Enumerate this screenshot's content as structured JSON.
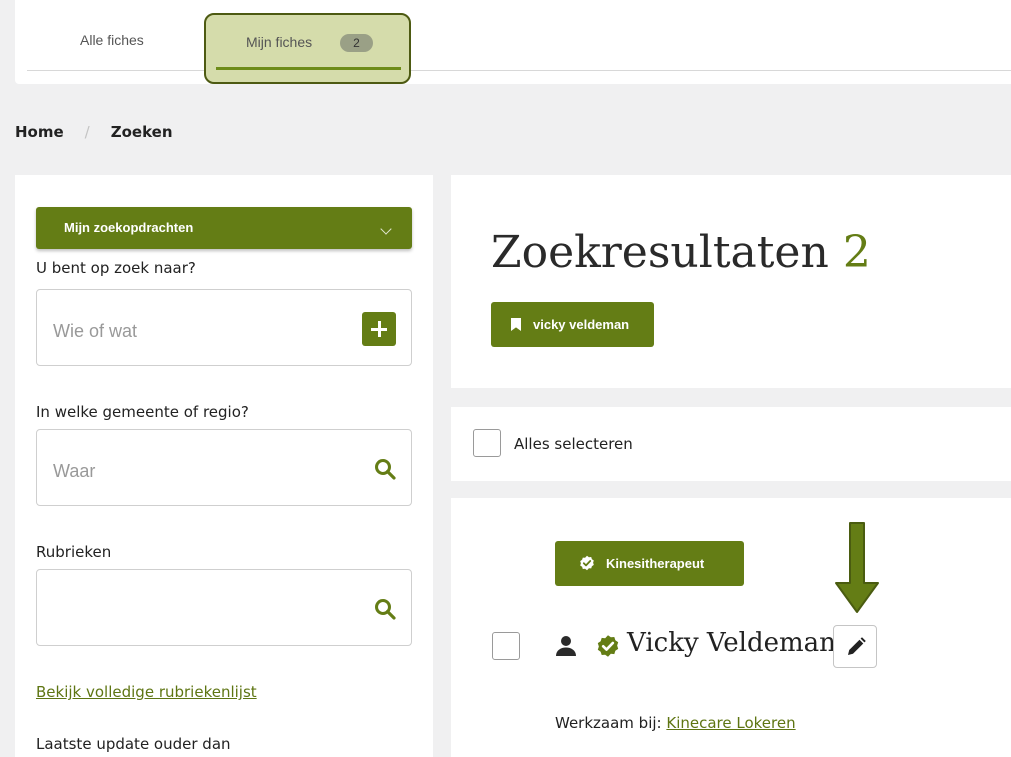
{
  "tabs": {
    "all_label": "Alle fiches",
    "mine_label": "Mijn fiches",
    "mine_count": "2"
  },
  "breadcrumb": {
    "home": "Home",
    "separator": "/",
    "current": "Zoeken"
  },
  "sidebar": {
    "my_searches_label": "Mijn zoekopdrachten",
    "what_label": "U bent op zoek naar?",
    "what_placeholder": "Wie of wat",
    "where_label": "In welke gemeente of regio?",
    "where_placeholder": "Waar",
    "categories_label": "Rubrieken",
    "categories_value": "",
    "full_list_link": "Bekijk volledige rubriekenlijst",
    "last_update_label": "Laatste update ouder dan"
  },
  "results": {
    "title": "Zoekresultaten",
    "count": "2",
    "saved_search_label": "vicky veldeman",
    "select_all_label": "Alles selecteren",
    "items": [
      {
        "badge": "Kinesitherapeut",
        "name": "Vicky Veldeman",
        "works_at_label": "Werkzaam bij:",
        "works_at_link": "Kinecare Lokeren"
      }
    ]
  },
  "colors": {
    "brand_green": "#647d15",
    "link_green": "#5e7512",
    "highlight_fill": "#d5dcab",
    "highlight_border": "#4d5a12",
    "page_bg": "#f0f0f1"
  },
  "icons": {
    "tab_count": "count-pill",
    "dropdown": "chevron-down-icon",
    "add": "plus-icon",
    "search": "search-icon",
    "bookmark": "bookmark-icon",
    "verified": "verified-badge-icon",
    "person": "person-icon",
    "edit": "pencil-icon",
    "annotation": "down-arrow-icon"
  }
}
